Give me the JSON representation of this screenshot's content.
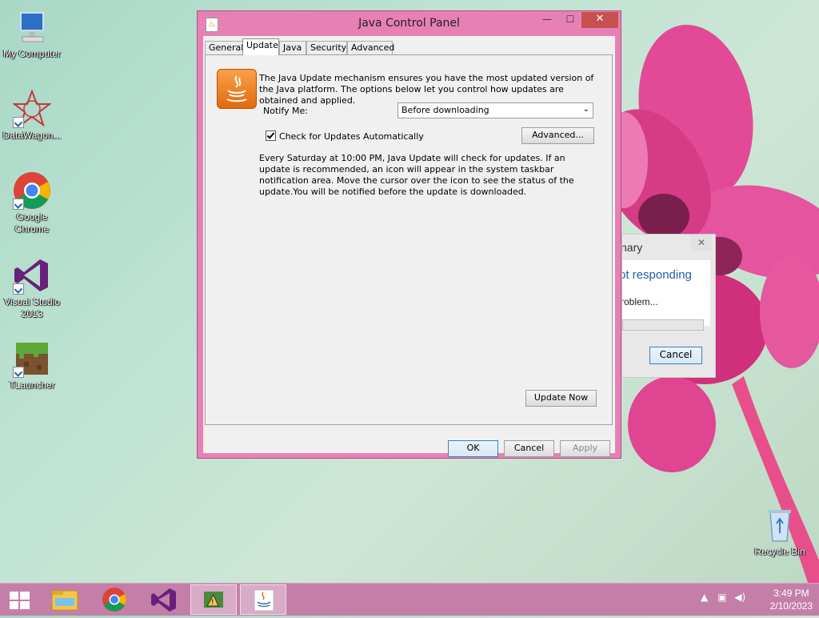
{
  "desktop": {
    "icons": [
      {
        "label": "My Computer",
        "icon": "computer-icon"
      },
      {
        "label": "DataWagon...",
        "icon": "datawagon-icon"
      },
      {
        "label": "Google Chrome",
        "icon": "chrome-icon"
      },
      {
        "label": "Visual Studio 2013",
        "icon": "visual-studio-icon"
      },
      {
        "label": "TLauncher",
        "icon": "minecraft-icon"
      },
      {
        "label": "Recycle Bin",
        "icon": "recycle-bin-icon"
      }
    ]
  },
  "window": {
    "title": "Java Control Panel",
    "controls": {
      "minimize": "—",
      "maximize": "☐",
      "close": "✕"
    },
    "tabs": [
      "General",
      "Update",
      "Java",
      "Security",
      "Advanced"
    ],
    "active_tab": "Update",
    "update": {
      "intro": "The Java Update mechanism ensures you have the most updated version of the Java platform. The options below let you control how updates are obtained and applied.",
      "notify_label": "Notify Me:",
      "notify_value": "Before downloading",
      "check_label": "Check for Updates Automatically",
      "check_checked": true,
      "advanced_button": "Advanced...",
      "schedule_text": "Every Saturday at 10:00 PM, Java Update will check for updates. If an update is recommended, an icon will appear in the system taskbar notification area. Move the cursor over the icon to see the status of the update.You will be notified before the update is downloaded.",
      "update_now_button": "Update Now"
    },
    "buttons": {
      "ok": "OK",
      "cancel": "Cancel",
      "apply": "Apply"
    }
  },
  "background_dialog": {
    "title_fragment": "nary",
    "heading_fragment": "ot responding",
    "message_fragment": "roblem...",
    "cancel_button": "Cancel"
  },
  "taskbar": {
    "items": [
      "file-explorer-icon",
      "chrome-icon",
      "visual-studio-icon",
      "app-icon",
      "java-icon"
    ],
    "clock_time": "3:49 PM",
    "clock_date": "2/10/2023"
  },
  "colors": {
    "window_frame": "#e780b5",
    "taskbar": "#c47fa8",
    "close_button": "#c75050",
    "accent_blue": "#1f5da8"
  }
}
